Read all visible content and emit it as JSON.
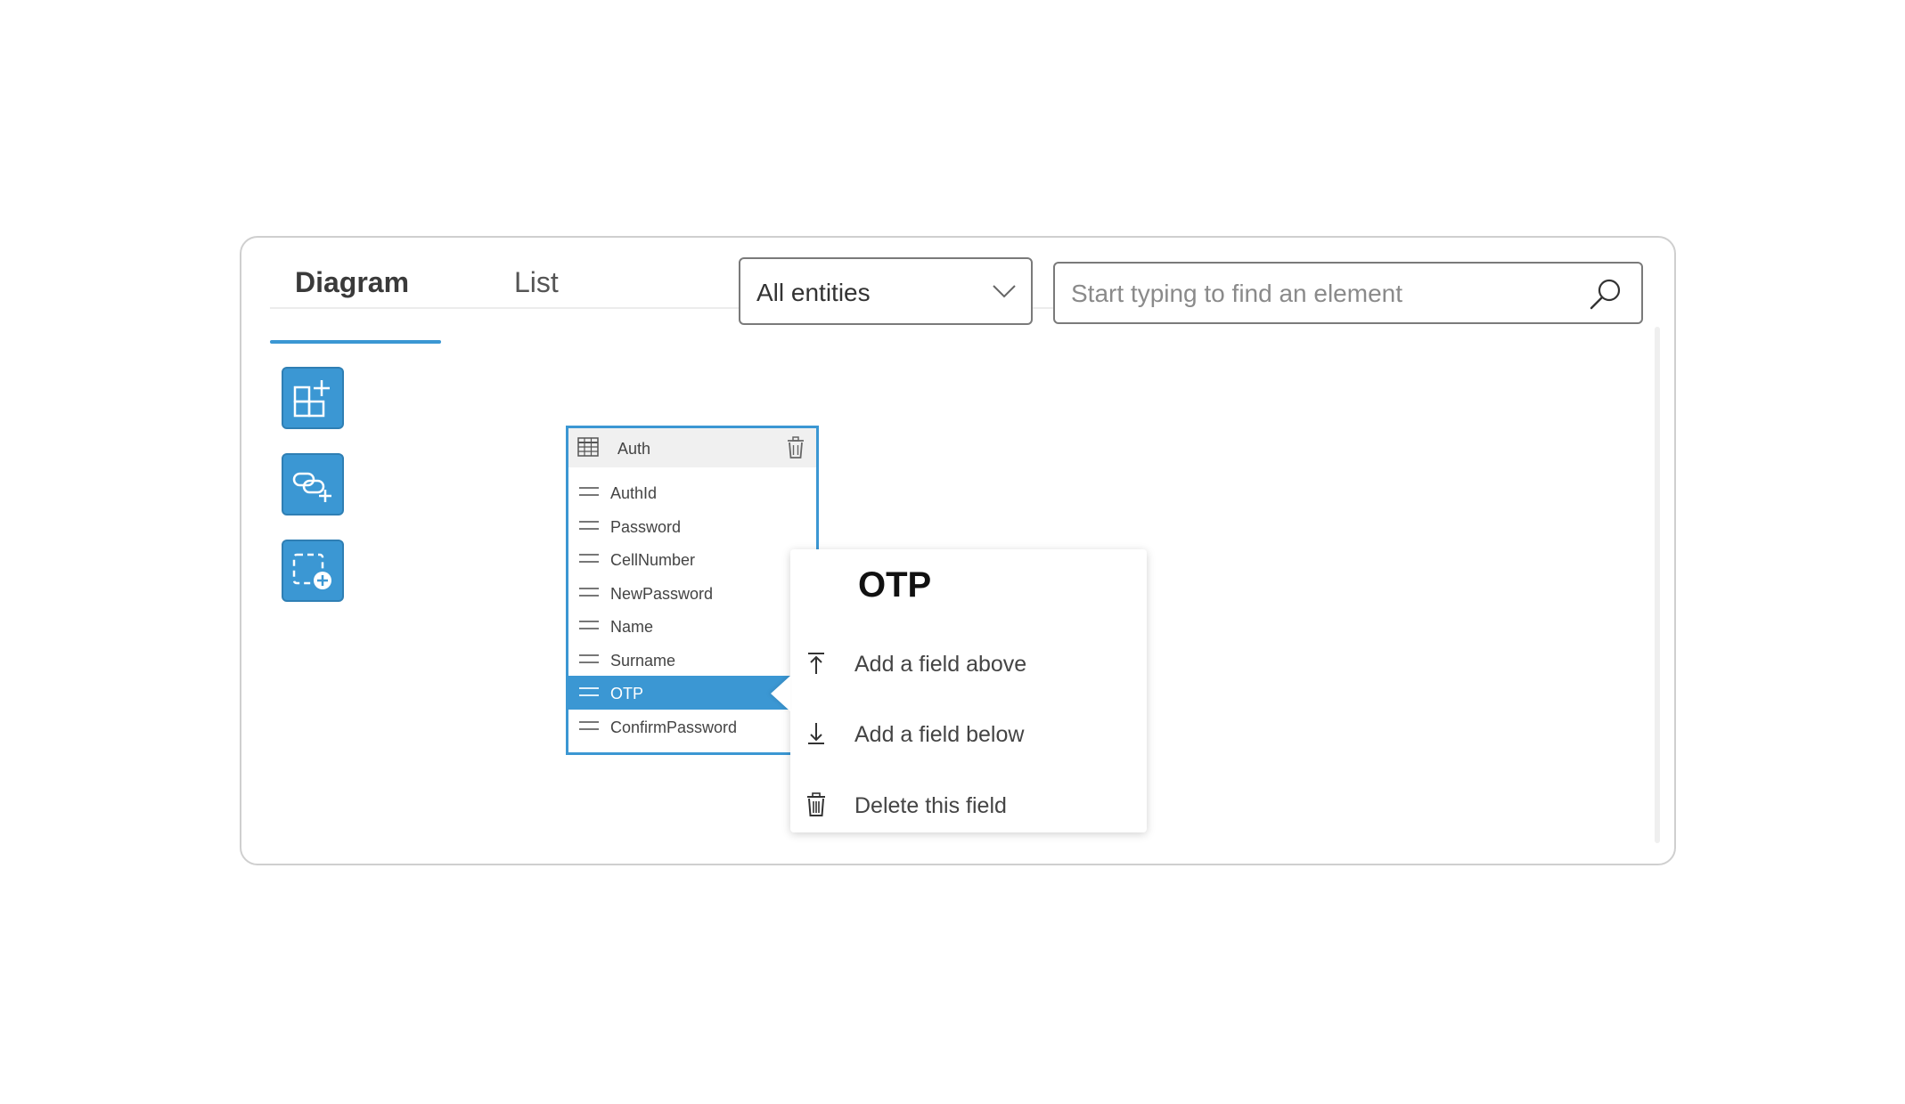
{
  "tabs": [
    {
      "label": "Diagram",
      "active": true
    },
    {
      "label": "List",
      "active": false
    }
  ],
  "filter": {
    "selected": "All entities"
  },
  "search": {
    "placeholder": "Start typing to find an element",
    "value": ""
  },
  "toolbar": {
    "buttons": [
      {
        "icon": "add-entity-icon"
      },
      {
        "icon": "add-relationship-icon"
      },
      {
        "icon": "add-group-icon"
      }
    ]
  },
  "entity": {
    "name": "Auth",
    "fields": [
      "AuthId",
      "Password",
      "CellNumber",
      "NewPassword",
      "Name",
      "Surname",
      "OTP",
      "ConfirmPassword"
    ],
    "selected_field": "OTP"
  },
  "context_menu": {
    "title": "OTP",
    "items": [
      {
        "label": "Add a field above",
        "icon": "arrow-up-to-line-icon"
      },
      {
        "label": "Add a field below",
        "icon": "arrow-down-to-line-icon"
      },
      {
        "label": "Delete this field",
        "icon": "trash-icon"
      }
    ]
  },
  "colors": {
    "accent": "#3b97d3",
    "border": "#cfcfcf",
    "text": "#444444"
  }
}
